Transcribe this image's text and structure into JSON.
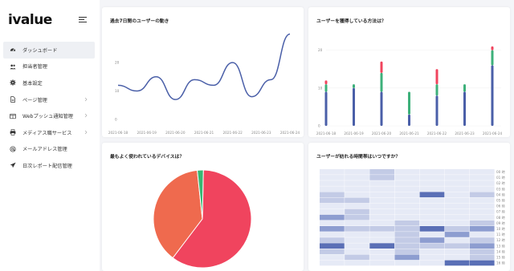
{
  "brand": "ivalue",
  "nav": [
    {
      "label": "ダッシュボード",
      "icon": "dashboard-gauge-icon",
      "active": true,
      "chevron": false
    },
    {
      "label": "担当者管理",
      "icon": "users-icon",
      "active": false,
      "chevron": false
    },
    {
      "label": "基本設定",
      "icon": "gear-icon",
      "active": false,
      "chevron": false
    },
    {
      "label": "ページ管理",
      "icon": "document-icon",
      "active": false,
      "chevron": true
    },
    {
      "label": "Webプッシュ通知管理",
      "icon": "window-icon",
      "active": false,
      "chevron": true
    },
    {
      "label": "メディアス職サービス",
      "icon": "printer-icon",
      "active": false,
      "chevron": true
    },
    {
      "label": "メールアドレス管理",
      "icon": "at-icon",
      "active": false,
      "chevron": false
    },
    {
      "label": "日次レポート配信管理",
      "icon": "send-icon",
      "active": false,
      "chevron": false
    }
  ],
  "cards": {
    "line_title": "過去7日間のユーザーの動き",
    "stack_title": "ユーザーを獲得している方法は？",
    "pie_title": "最もよく使われているデバイスは？",
    "heat_title": "ユーザーが訪れる時間帯はいつですか？"
  },
  "colors": {
    "line": "#4a5fa8",
    "blue": "#4a5fa8",
    "green": "#3db07a",
    "red": "#f0445e",
    "pie_red": "#f0445e",
    "pie_orange": "#ef6a4e",
    "pie_green": "#36b872",
    "heat_base": "#e6eaf6"
  },
  "chart_data": [
    {
      "type": "line",
      "title": "過去7日間のユーザーの動き",
      "x": [
        "2021-06-18",
        "2021-06-19",
        "2021-06-20",
        "2021-06-21",
        "2021-06-22",
        "2021-06-23",
        "2021-06-24"
      ],
      "values": [
        12,
        10,
        15,
        7,
        14,
        12,
        20,
        8,
        14,
        30
      ],
      "yticks": [
        0,
        10,
        20
      ],
      "ylim": [
        0,
        31
      ]
    },
    {
      "type": "bar",
      "title": "ユーザーを獲得している方法は？",
      "x": [
        "2021-06-18",
        "2021-06-19",
        "2021-06-20",
        "2021-06-21",
        "2021-06-22",
        "2021-06-23",
        "2021-06-24"
      ],
      "series": [
        {
          "color": "blue",
          "values": [
            9,
            10,
            9,
            3,
            8,
            9,
            16
          ]
        },
        {
          "color": "green",
          "values": [
            2,
            1,
            5,
            6,
            3,
            2,
            4
          ]
        },
        {
          "color": "red",
          "values": [
            1,
            0,
            3,
            0,
            4,
            0,
            1
          ]
        }
      ],
      "yticks": [
        0,
        10,
        20
      ],
      "ylim": [
        0,
        25
      ]
    },
    {
      "type": "pie",
      "title": "最もよく使われているデバイスは？",
      "slices": [
        {
          "color": "pie_red",
          "value": 60
        },
        {
          "color": "pie_orange",
          "value": 38
        },
        {
          "color": "pie_green",
          "value": 2
        }
      ]
    },
    {
      "type": "heatmap",
      "title": "ユーザーが訪れる時間帯はいつですか？",
      "rows": [
        "00 時",
        "01 時",
        "02 時",
        "03 時",
        "04 時",
        "05 時",
        "06 時",
        "07 時",
        "08 時",
        "09 時",
        "10 時",
        "11 時",
        "12 時",
        "13 時",
        "14 時",
        "15 時",
        "16 時"
      ],
      "columns": 7,
      "values": [
        [
          0,
          0,
          1,
          0,
          0,
          0,
          0
        ],
        [
          0,
          0,
          1,
          0,
          0,
          0,
          0
        ],
        [
          0,
          0,
          0,
          0,
          0,
          0,
          0
        ],
        [
          0,
          0,
          0,
          0,
          0,
          0,
          0
        ],
        [
          1,
          0,
          0,
          0,
          3,
          0,
          1
        ],
        [
          1,
          1,
          0,
          0,
          0,
          0,
          0
        ],
        [
          0,
          0,
          0,
          0,
          0,
          0,
          0
        ],
        [
          0,
          1,
          0,
          0,
          0,
          0,
          0
        ],
        [
          2,
          1,
          0,
          0,
          0,
          0,
          0
        ],
        [
          0,
          0,
          0,
          1,
          0,
          0,
          1
        ],
        [
          2,
          1,
          1,
          1,
          3,
          1,
          2
        ],
        [
          0,
          0,
          0,
          1,
          0,
          2,
          0
        ],
        [
          1,
          0,
          0,
          1,
          2,
          0,
          1
        ],
        [
          3,
          0,
          3,
          1,
          1,
          1,
          2
        ],
        [
          1,
          0,
          0,
          1,
          0,
          0,
          1
        ],
        [
          0,
          1,
          0,
          2,
          0,
          0,
          1
        ],
        [
          0,
          0,
          0,
          0,
          0,
          3,
          3
        ]
      ]
    }
  ]
}
